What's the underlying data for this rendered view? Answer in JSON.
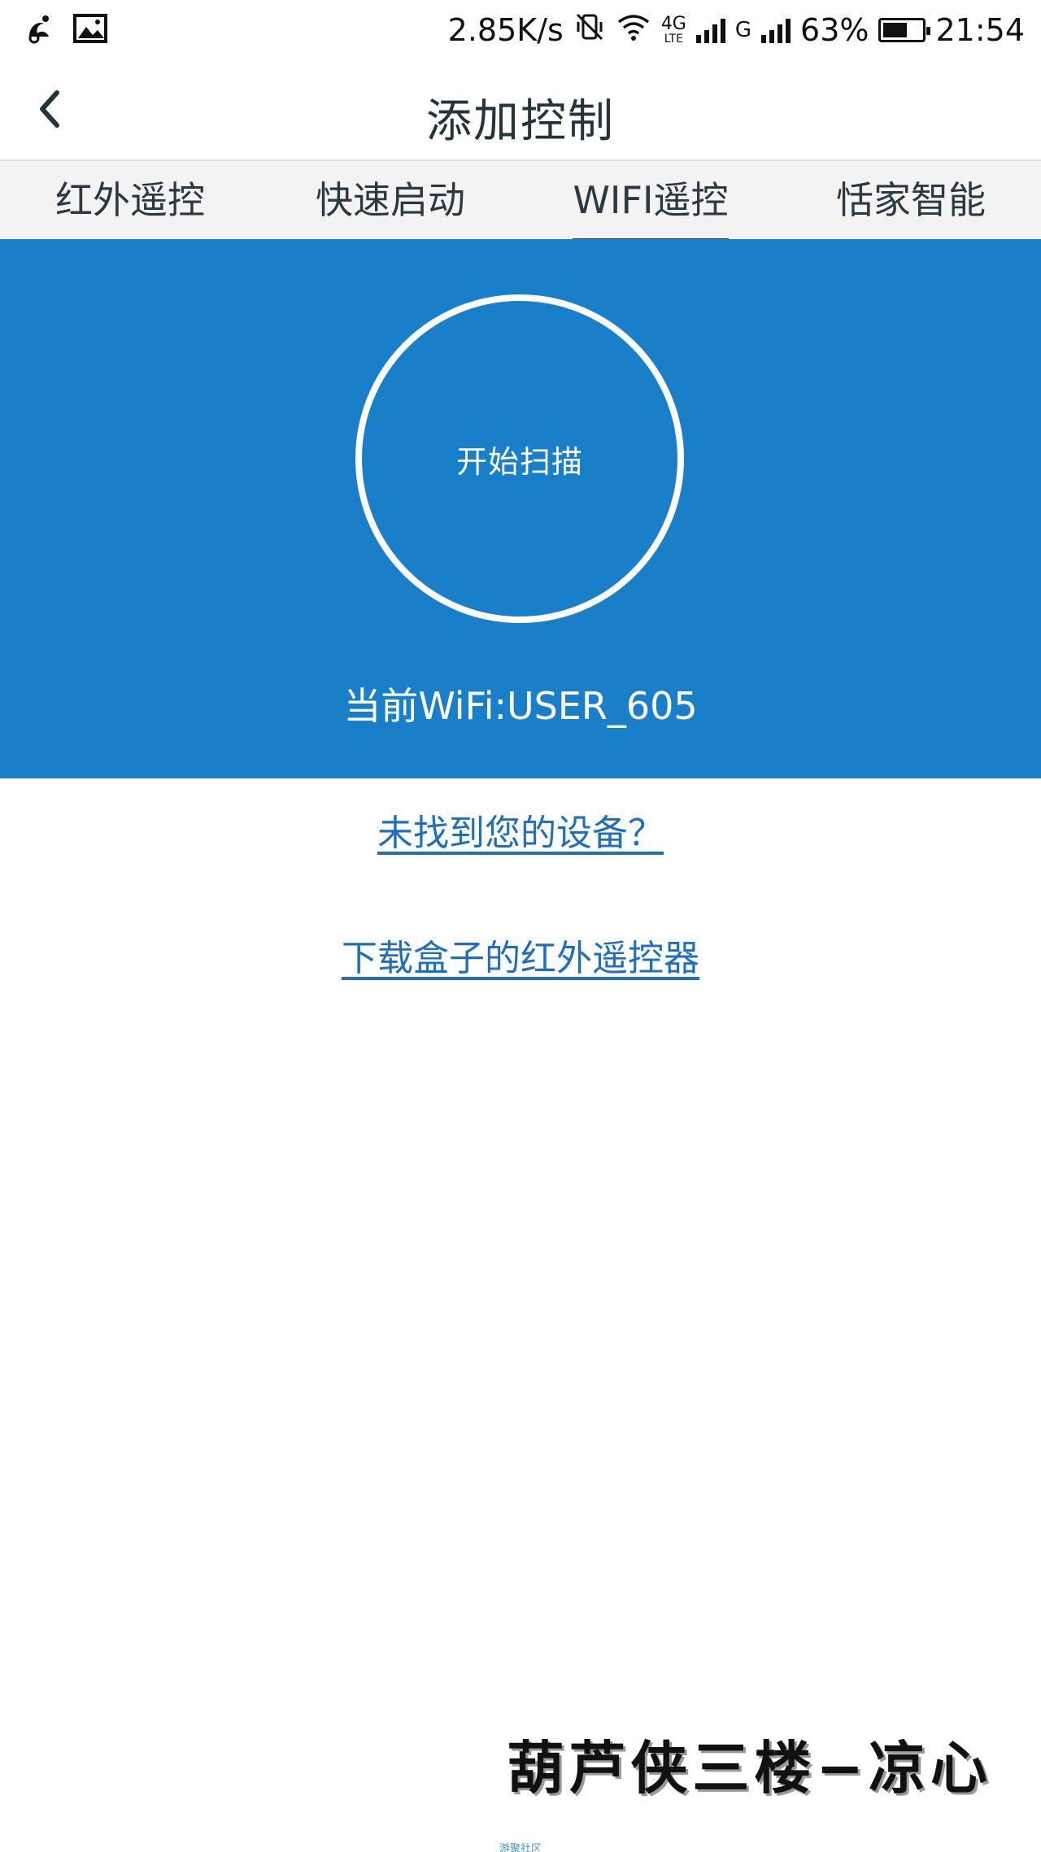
{
  "status_bar": {
    "left_icons": [
      "uc-browser-icon",
      "image-icon"
    ],
    "net_speed": "2.85K/s",
    "network_1_label_top": "4G",
    "network_1_label_bottom": "LTE",
    "network_2_label": "G",
    "battery_percent": "63%",
    "battery_level": 0.63,
    "time": "21:54"
  },
  "header": {
    "back_icon": "chevron-left-icon",
    "title": "添加控制"
  },
  "tabs": [
    {
      "label": "红外遥控",
      "active": false
    },
    {
      "label": "快速启动",
      "active": false
    },
    {
      "label": "WIFI遥控",
      "active": true
    },
    {
      "label": "恬家智能",
      "active": false
    }
  ],
  "scan": {
    "button_label": "开始扫描",
    "current_wifi": "当前WiFi:USER_605"
  },
  "links": {
    "not_found": "未找到您的设备？",
    "download": "下载盒子的红外遥控器"
  },
  "watermark": "葫芦侠三楼−凉心",
  "footer_mark": "游聚社区",
  "colors": {
    "accent_blue": "#1a7fc9",
    "link_blue": "#1f6fc0",
    "tab_bg": "#f3f3f3"
  }
}
